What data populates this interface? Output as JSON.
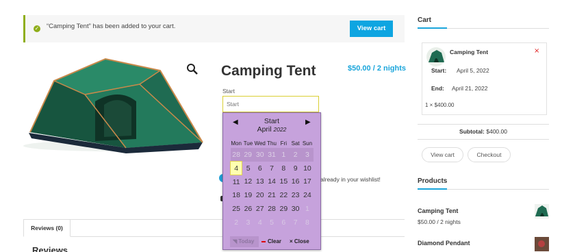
{
  "notice": {
    "message": "“Camping Tent” has been added to your cart.",
    "button": "View cart"
  },
  "product": {
    "title": "Camping Tent",
    "price": "$50.00 / 2 nights",
    "start_label": "Start",
    "start_placeholder": "Start",
    "wishlist_text": "already in your wishlist!"
  },
  "calendar": {
    "title": "Start",
    "month": "April",
    "year": "2022",
    "prev": "◀",
    "next": "▶",
    "weekdays": [
      "Mon",
      "Tue",
      "Wed",
      "Thu",
      "Fri",
      "Sat",
      "Sun"
    ],
    "rows": [
      [
        "28",
        "29",
        "30",
        "31",
        "1",
        "2",
        "3"
      ],
      [
        "4",
        "5",
        "6",
        "7",
        "8",
        "9",
        "10"
      ],
      [
        "11",
        "12",
        "13",
        "14",
        "15",
        "16",
        "17"
      ],
      [
        "18",
        "19",
        "20",
        "21",
        "22",
        "23",
        "24"
      ],
      [
        "25",
        "26",
        "27",
        "28",
        "29",
        "30",
        "1"
      ],
      [
        "2",
        "3",
        "4",
        "5",
        "6",
        "7",
        "8"
      ]
    ],
    "today_day": "4",
    "today_btn": "Today",
    "clear_btn": "Clear",
    "close_btn": "Close"
  },
  "tabs": {
    "reviews_tab": "Reviews (0)",
    "reviews_heading": "Reviews"
  },
  "cart": {
    "heading": "Cart",
    "item_name": "Camping Tent",
    "remove": "×",
    "start_label": "Start:",
    "start_value": "April 5, 2022",
    "end_label": "End:",
    "end_value": "April 21, 2022",
    "qty_line": "1 × $400.00",
    "subtotal_label": "Subtotal:",
    "subtotal_value": "$400.00",
    "view_cart": "View cart",
    "checkout": "Checkout"
  },
  "products": {
    "heading": "Products",
    "items": [
      {
        "name": "Camping Tent",
        "price": "$50.00 / 2 nights"
      },
      {
        "name": "Diamond Pendant",
        "price": ""
      }
    ]
  },
  "colors": {
    "accent": "#1aa5db",
    "calendar_bg": "#c6a2dc",
    "notice_border": "#8fae1b",
    "remove": "#e02020"
  }
}
